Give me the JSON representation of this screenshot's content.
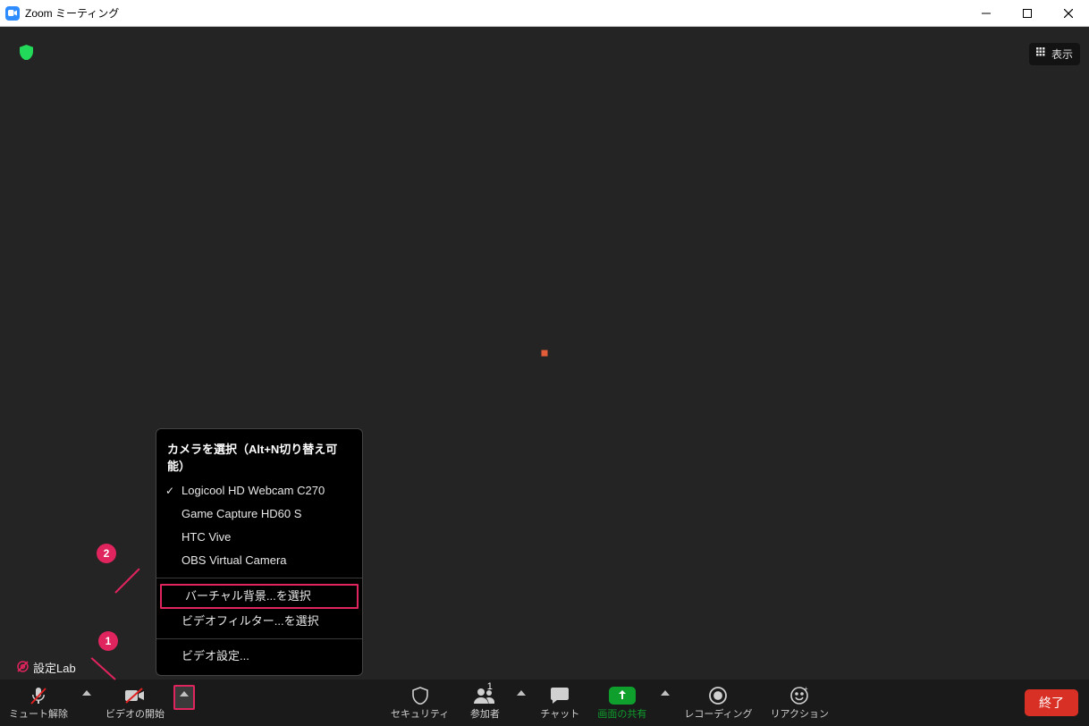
{
  "window": {
    "title": "Zoom ミーティング"
  },
  "topbar": {
    "view_label": "表示"
  },
  "settings_lab": "設定Lab",
  "popup": {
    "section_title": "カメラを選択（Alt+N切り替え可能）",
    "cameras": [
      {
        "label": "Logicool HD Webcam C270",
        "checked": true
      },
      {
        "label": "Game Capture HD60 S",
        "checked": false
      },
      {
        "label": "HTC Vive",
        "checked": false
      },
      {
        "label": "OBS Virtual Camera",
        "checked": false
      }
    ],
    "virtual_bg": "バーチャル背景...を選択",
    "video_filter": "ビデオフィルター...を選択",
    "video_settings": "ビデオ設定..."
  },
  "toolbar": {
    "mute": "ミュート解除",
    "video": "ビデオの開始",
    "security": "セキュリティ",
    "participants": "参加者",
    "participants_count": "1",
    "chat": "チャット",
    "share": "画面の共有",
    "record": "レコーディング",
    "reactions": "リアクション",
    "end": "終了"
  },
  "annotations": {
    "a1": "1",
    "a2": "2"
  }
}
